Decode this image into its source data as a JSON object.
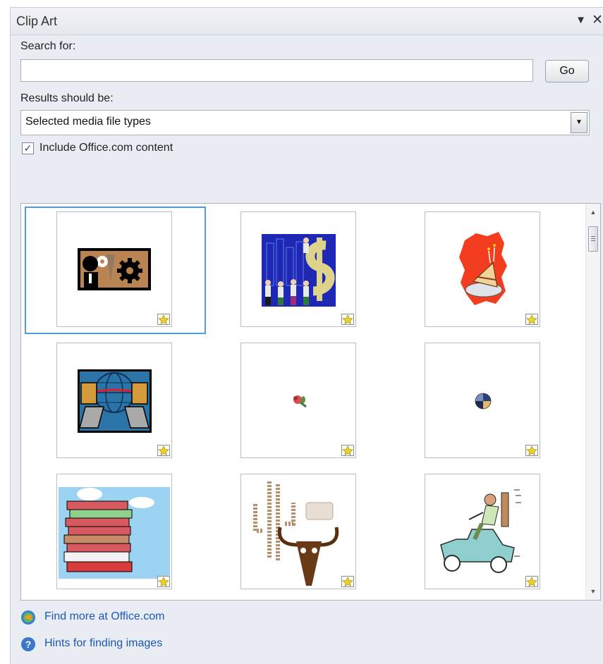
{
  "pane": {
    "title": "Clip Art",
    "menu_icon": "chevron-down-icon",
    "close_icon": "close-icon"
  },
  "search": {
    "label": "Search for:",
    "value": "",
    "placeholder": "",
    "go_label": "Go"
  },
  "results_filter": {
    "label": "Results should be:",
    "selected": "Selected media file types"
  },
  "include_office": {
    "label": "Include Office.com content",
    "checked": true
  },
  "results": {
    "items": [
      {
        "icon": "business-gears-clipart-icon",
        "selected": true
      },
      {
        "icon": "business-people-dollar-clipart-icon"
      },
      {
        "icon": "birthday-cake-clipart-icon"
      },
      {
        "icon": "computers-globe-clipart-icon"
      },
      {
        "icon": "rose-clipart-icon"
      },
      {
        "icon": "pie-chart-ball-clipart-icon"
      },
      {
        "icon": "stacked-books-clipart-icon"
      },
      {
        "icon": "cactus-skull-clipart-icon"
      },
      {
        "icon": "golf-cart-clipart-icon"
      }
    ],
    "badge_icon": "office-com-star-icon"
  },
  "links": [
    {
      "label": "Find more at Office.com",
      "icon": "office-com-globe-icon"
    },
    {
      "label": "Hints for finding images",
      "icon": "help-question-icon"
    }
  ],
  "colors": {
    "link": "#1a56b8",
    "selection": "#4d9be6",
    "pane_bg": "#e9edf3"
  }
}
